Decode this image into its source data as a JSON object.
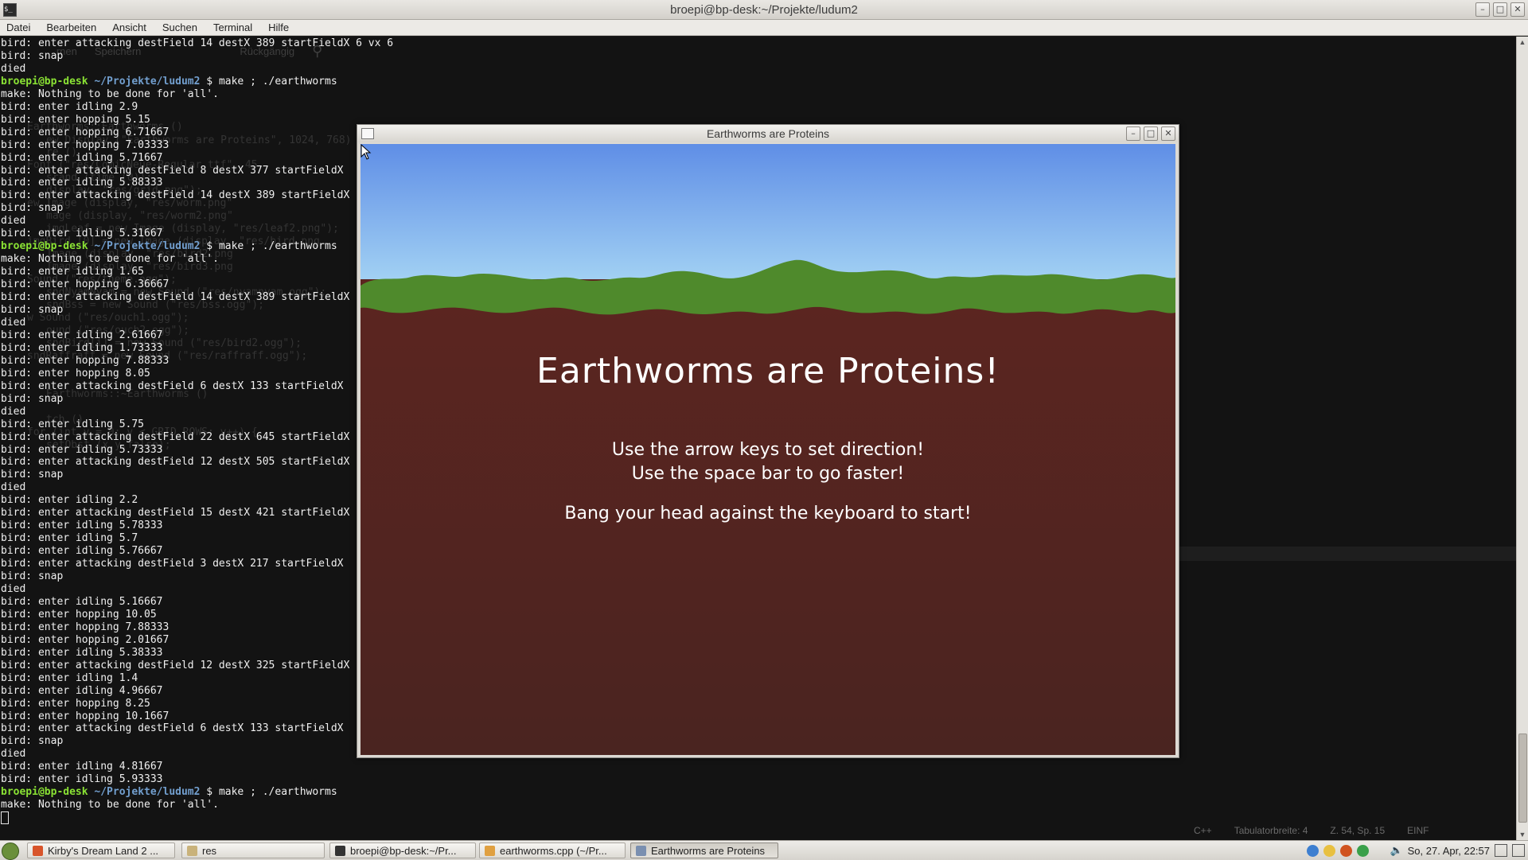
{
  "window": {
    "title": "broepi@bp-desk:~/Projekte/ludum2",
    "term_icon": "$_"
  },
  "menu": [
    "Datei",
    "Bearbeiten",
    "Ansicht",
    "Suchen",
    "Terminal",
    "Hilfe"
  ],
  "background_editor": {
    "toolbar": [
      "...rnen",
      "Speichern",
      "Rückgängig"
    ],
    "code": [
      "Earthworms::Earthworms ()",
      "ew Display (\"Earthworms are Proteins\", 1024, 768)",
      "re ()",
      "Font (\"res/ComicNeue-Regular.ttf\", 45",
      "srand (time (0));",
      "display, \"res/grid.png\");",
      "ew Image (display, \"res/worm.png\"",
      "mage (display, \"res/worm2.png\"",
      "imgLeaf = new Image (display, \"res/leaf2.png\");",
      "imgBird [0] = new Image (display, \"res/bird.png",
      "Image (display, \"res/bird2.png",
      "Image (display, \"res/bird3.png",
      "Sound (\"res/theme.ogg\");",
      "sndNyamNyam = new Sound (\"res/nyamnyam.ogg\");",
      "sndBss = new Sound (\"res/bss.ogg\");",
      "w Sound (\"res/ouch1.ogg\");",
      "ound (\"res/ouch2.ogg\");",
      "sndBird[i] = new Sound (\"res/bird2.ogg\");",
      "sndRaffraff = new Sound (\"res/raffraff.ogg\");",
      "Earthworms::~Earthworms ()",
      "tch ()",
      "for (int y = 0; y < GRID_ROWS; y++) {",
      "setObst (x,y,false);"
    ],
    "status": [
      "C++",
      "Tabulatorbreite: 4",
      "Z. 54, Sp. 15",
      "EINF"
    ]
  },
  "terminal_lines": [
    {
      "t": "bird: enter attacking destField 14 destX 389 startFieldX 6 vx 6"
    },
    {
      "t": "bird: snap"
    },
    {
      "t": "died"
    },
    {
      "user": "broepi@bp-desk",
      "path": "~/Projekte/ludum2",
      "cmd": " $ make ; ./earthworms"
    },
    {
      "t": "make: Nothing to be done for 'all'."
    },
    {
      "t": "bird: enter idling 2.9"
    },
    {
      "t": "bird: enter hopping 5.15"
    },
    {
      "t": "bird: enter hopping 6.71667"
    },
    {
      "t": "bird: enter hopping 7.03333"
    },
    {
      "t": "bird: enter idling 5.71667"
    },
    {
      "t": "bird: enter attacking destField 8 destX 377 startFieldX"
    },
    {
      "t": "bird: enter idling 5.88333"
    },
    {
      "t": "bird: enter attacking destField 14 destX 389 startFieldX"
    },
    {
      "t": "bird: snap"
    },
    {
      "t": "died"
    },
    {
      "t": "bird: enter idling 5.31667"
    },
    {
      "user": "broepi@bp-desk",
      "path": "~/Projekte/ludum2",
      "cmd": " $ make ; ./earthworms"
    },
    {
      "t": "make: Nothing to be done for 'all'."
    },
    {
      "t": "bird: enter idling 1.65"
    },
    {
      "t": "bird: enter hopping 6.36667"
    },
    {
      "t": "bird: enter attacking destField 14 destX 389 startFieldX"
    },
    {
      "t": "bird: snap"
    },
    {
      "t": "died"
    },
    {
      "t": "bird: enter idling 2.61667"
    },
    {
      "t": "bird: enter idling 1.73333"
    },
    {
      "t": "bird: enter hopping 7.88333"
    },
    {
      "t": "bird: enter hopping 8.05"
    },
    {
      "t": "bird: enter attacking destField 6 destX 133 startFieldX"
    },
    {
      "t": "bird: snap"
    },
    {
      "t": "died"
    },
    {
      "t": "bird: enter idling 5.75"
    },
    {
      "t": "bird: enter attacking destField 22 destX 645 startFieldX"
    },
    {
      "t": "bird: enter idling 5.73333"
    },
    {
      "t": "bird: enter attacking destField 12 destX 505 startFieldX"
    },
    {
      "t": "bird: snap"
    },
    {
      "t": "died"
    },
    {
      "t": "bird: enter idling 2.2"
    },
    {
      "t": "bird: enter attacking destField 15 destX 421 startFieldX"
    },
    {
      "t": "bird: enter idling 5.78333"
    },
    {
      "t": "bird: enter idling 5.7"
    },
    {
      "t": "bird: enter idling 5.76667"
    },
    {
      "t": "bird: enter attacking destField 3 destX 217 startFieldX"
    },
    {
      "t": "bird: snap"
    },
    {
      "t": "died"
    },
    {
      "t": "bird: enter idling 5.16667"
    },
    {
      "t": "bird: enter hopping 10.05"
    },
    {
      "t": "bird: enter hopping 7.88333"
    },
    {
      "t": "bird: enter hopping 2.01667"
    },
    {
      "t": "bird: enter idling 5.38333"
    },
    {
      "t": "bird: enter attacking destField 12 destX 325 startFieldX"
    },
    {
      "t": "bird: enter idling 1.4"
    },
    {
      "t": "bird: enter idling 4.96667"
    },
    {
      "t": "bird: enter hopping 8.25"
    },
    {
      "t": "bird: enter hopping 10.1667"
    },
    {
      "t": "bird: enter attacking destField 6 destX 133 startFieldX"
    },
    {
      "t": "bird: snap"
    },
    {
      "t": "died"
    },
    {
      "t": "bird: enter idling 4.81667"
    },
    {
      "t": "bird: enter idling 5.93333"
    },
    {
      "user": "broepi@bp-desk",
      "path": "~/Projekte/ludum2",
      "cmd": " $ make ; ./earthworms"
    },
    {
      "t": "make: Nothing to be done for 'all'."
    }
  ],
  "game": {
    "window_title": "Earthworms are Proteins",
    "heading": "Earthworms are Proteins!",
    "line1": "Use the arrow keys to set direction!",
    "line2": "Use the space bar to go faster!",
    "line3": "Bang your head against the keyboard to start!",
    "colors": {
      "sky_top": "#5f8ee6",
      "sky_bottom": "#a9d8f5",
      "grass": "#4f8a2c",
      "soil": "#5a2420"
    }
  },
  "taskbar": {
    "tasks": [
      {
        "label": "Kirby's Dream Land 2 ...",
        "icon": "firefox-icon",
        "color": "#d8542a"
      },
      {
        "label": "res",
        "icon": "folder-icon",
        "color": "#c9b27a"
      },
      {
        "label": "broepi@bp-desk:~/Pr...",
        "icon": "terminal-icon",
        "color": "#333333"
      },
      {
        "label": "earthworms.cpp (~/Pr...",
        "icon": "text-editor-icon",
        "color": "#e0a040"
      },
      {
        "label": "Earthworms are Proteins",
        "icon": "window-icon",
        "color": "#7a8fb0"
      }
    ],
    "clock": "So, 27. Apr, 22:57"
  }
}
